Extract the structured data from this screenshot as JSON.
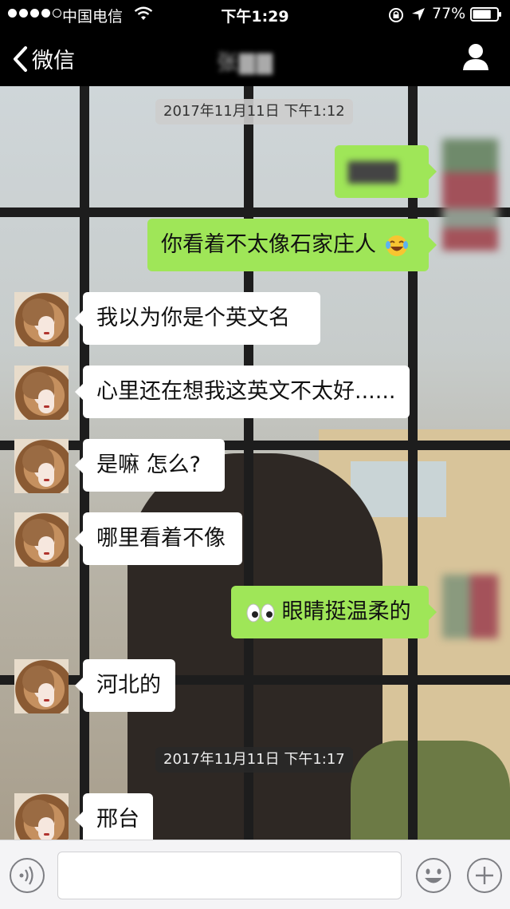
{
  "status_bar": {
    "carrier": "中国电信",
    "time": "下午1:29",
    "battery_percent": "77%",
    "battery_level": 0.77,
    "signal_bars": 4
  },
  "nav": {
    "back_label": "微信",
    "title": "张▇▇",
    "icons": [
      "chevron-left-icon",
      "person-icon"
    ]
  },
  "chat": {
    "timestamps": [
      "2017年11月11日 下午1:12",
      "2017年11月11日 下午1:17"
    ],
    "messages": [
      {
        "direction": "out",
        "text": "▇▇▇"
      },
      {
        "direction": "out",
        "text": "你看着不太像石家庄人",
        "emoji": "laughing-tears-emoji"
      },
      {
        "direction": "in",
        "text": "我以为你是个英文名"
      },
      {
        "direction": "in",
        "text": "心里还在想我这英文不太好......"
      },
      {
        "direction": "in",
        "text": "是嘛 怎么?"
      },
      {
        "direction": "in",
        "text": "哪里看着不像"
      },
      {
        "direction": "out",
        "text": "眼睛挺温柔的",
        "emoji": "eyes-emoji"
      },
      {
        "direction": "in",
        "text": "河北的"
      },
      {
        "direction": "in",
        "text": "邢台"
      }
    ]
  },
  "input_bar": {
    "value": "",
    "icons": [
      "voice-icon",
      "emoji-icon",
      "plus-icon"
    ]
  },
  "colors": {
    "incoming_bubble": "#ffffff",
    "outgoing_bubble": "#9fe658",
    "bars": "#000000",
    "input_bar": "#f4f4f6"
  }
}
